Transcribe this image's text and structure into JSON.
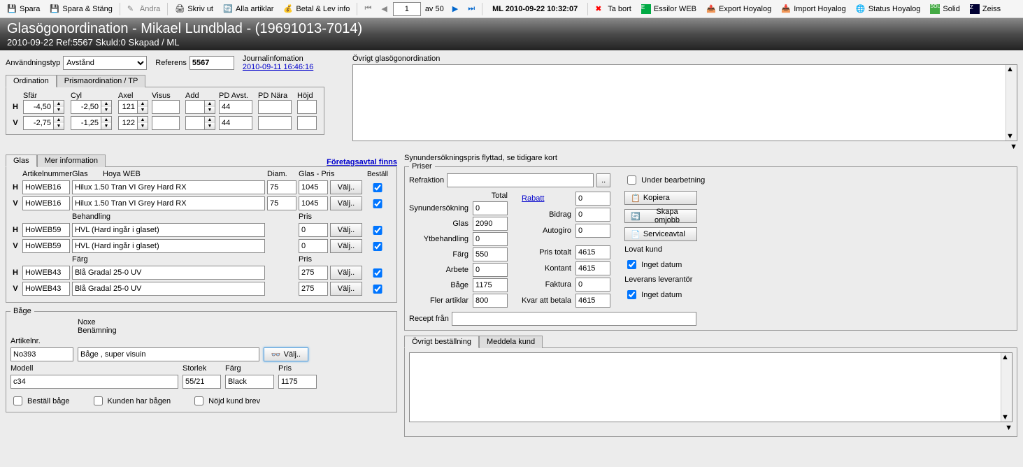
{
  "toolbar": {
    "save": "Spara",
    "save_close": "Spara & Stäng",
    "change": "Ändra",
    "print": "Skriv ut",
    "all_articles": "Alla artiklar",
    "pay_info": "Betal & Lev info",
    "page": "1",
    "of": "av 50",
    "timestamp": "ML 2010-09-22 10:32:07",
    "delete": "Ta bort",
    "essilor": "Essilor WEB",
    "export_hoyalog": "Export Hoyalog",
    "import_hoyalog": "Import Hoyalog",
    "status_hoyalog": "Status Hoyalog",
    "solid": "Solid",
    "zeiss": "Zeiss"
  },
  "header": {
    "title": "Glasögonordination - Mikael Lundblad - (19691013-7014)",
    "subtitle": "2010-09-22 Ref:5567  Skuld:0 Skapad / ML"
  },
  "top": {
    "usage_label": "Användningstyp",
    "usage_value": "Avstånd",
    "ref_label": "Referens",
    "ref_value": "5567",
    "journal_label": "Journalinfomation",
    "journal_link": "2010-09-11 16:46:16",
    "ovrigt_label": "Övrigt glasögonordination"
  },
  "ord": {
    "tabs": {
      "ordination": "Ordination",
      "prisma": "Prismaordination / TP"
    },
    "hdr": {
      "sfar": "Sfär",
      "cyl": "Cyl",
      "axel": "Axel",
      "visus": "Visus",
      "add": "Add",
      "pd_avst": "PD Avst.",
      "pd_nara": "PD Nära",
      "hojd": "Höjd"
    },
    "H": {
      "sfar": "-4,50",
      "cyl": "-2,50",
      "axel": "121",
      "visus": "",
      "add": "",
      "pd_avst": "44",
      "pd_nara": "",
      "hojd": ""
    },
    "V": {
      "sfar": "-2,75",
      "cyl": "-1,25",
      "axel": "122",
      "visus": "",
      "add": "",
      "pd_avst": "44",
      "pd_nara": "",
      "hojd": ""
    }
  },
  "glas": {
    "tabs": {
      "glas": "Glas",
      "mer": "Mer information"
    },
    "link": "Företagsavtal finns",
    "hdr": {
      "artnr": "Artikelnummer",
      "glas": "Glas",
      "brand": "Hoya  WEB",
      "diam": "Diam.",
      "pris": "Glas - Pris",
      "bestall": "Beställ",
      "behandling": "Behandling",
      "pris2": "Pris",
      "farg": "Färg"
    },
    "rows_glas": [
      {
        "side": "H",
        "art": "HoWEB16",
        "name": "Hilux 1.50 Tran VI Grey Hard RX",
        "diam": "75",
        "pris": "1045"
      },
      {
        "side": "V",
        "art": "HoWEB16",
        "name": "Hilux 1.50 Tran VI Grey Hard RX",
        "diam": "75",
        "pris": "1045"
      }
    ],
    "rows_beh": [
      {
        "side": "H",
        "art": "HoWEB59",
        "name": "HVL (Hard ingår i glaset)",
        "pris": "0"
      },
      {
        "side": "V",
        "art": "HoWEB59",
        "name": "HVL (Hard ingår i glaset)",
        "pris": "0"
      }
    ],
    "rows_farg": [
      {
        "side": "H",
        "art": "HoWEB43",
        "name": "Blå Gradal 25-0 UV",
        "pris": "275"
      },
      {
        "side": "V",
        "art": "HoWEB43",
        "name": "Blå Gradal 25-0 UV",
        "pris": "275"
      }
    ],
    "valj": "Välj.."
  },
  "bage": {
    "legend": "Båge",
    "artnr_label": "Artikelnr.",
    "noxe": "Noxe",
    "ben": "Benämning",
    "modell_label": "Modell",
    "storlek_label": "Storlek",
    "farg_label": "Färg",
    "pris_label": "Pris",
    "artnr": "No393",
    "name": "Båge , super visuin",
    "modell": "c34",
    "storlek": "55/21",
    "farg": "Black",
    "pris": "1175",
    "valj": "Välj..",
    "chk1": "Beställ båge",
    "chk2": "Kunden har bågen",
    "chk3": "Nöjd kund brev"
  },
  "priser": {
    "note": "Synundersökningspris flyttad, se tidigare kort",
    "legend": "Priser",
    "refraktion_label": "Refraktion",
    "total": "Total",
    "syn": "Synundersökning",
    "syn_v": "0",
    "glas_l": "Glas",
    "glas_v": "2090",
    "yt": "Ytbehandling",
    "yt_v": "0",
    "farg": "Färg",
    "farg_v": "550",
    "arbete": "Arbete",
    "arbete_v": "0",
    "bage_l": "Båge",
    "bage_v": "1175",
    "fler": "Fler artiklar",
    "fler_v": "800",
    "rabatt": "Rabatt",
    "rabatt_v": "0",
    "bidrag": "Bidrag",
    "bidrag_v": "0",
    "autogiro": "Autogiro",
    "autogiro_v": "0",
    "pris_totalt": "Pris totalt",
    "pris_totalt_v": "4615",
    "kontant": "Kontant",
    "kontant_v": "4615",
    "faktura": "Faktura",
    "faktura_v": "0",
    "kvar": "Kvar att betala",
    "kvar_v": "4615",
    "under": "Under bearbetning",
    "kopiera": "Kopiera",
    "skapa": "Skapa omjobb",
    "serviceavtal": "Serviceavtal",
    "lovat": "Lovat kund",
    "inget1": "Inget datum",
    "lev": "Leverans leverantör",
    "inget2": "Inget datum",
    "recept": "Recept från"
  },
  "bottom_tabs": {
    "ovrigt": "Övrigt beställning",
    "meddela": "Meddela kund"
  }
}
